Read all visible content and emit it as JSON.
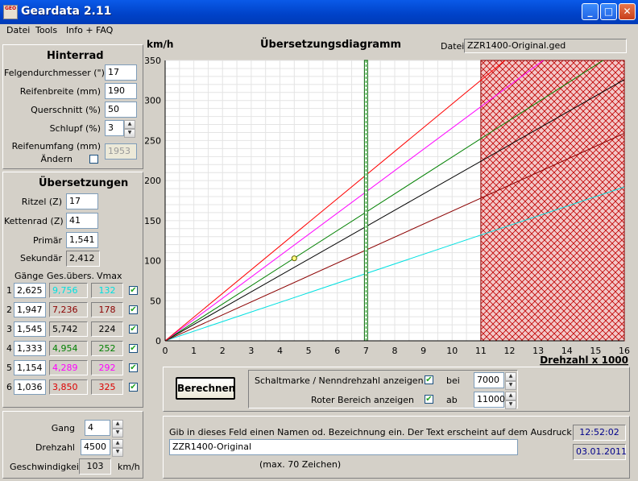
{
  "window": {
    "title": "Geardata 2.11",
    "icon_text": "GEO"
  },
  "menu": [
    "Datei",
    "Tools",
    "Info + FAQ"
  ],
  "hinterrad": {
    "title": "Hinterrad",
    "felge_label": "Felgendurchmesser (\")",
    "felge_value": "17",
    "breite_label": "Reifenbreite (mm)",
    "breite_value": "190",
    "quer_label": "Querschnitt (%)",
    "quer_value": "50",
    "schlupf_label": "Schlupf (%)",
    "schlupf_value": "3",
    "umfang_label": "Reifenumfang (mm)",
    "umfang_value": "1953",
    "aendern_label": "Ändern"
  },
  "uebersetzungen": {
    "title": "Übersetzungen",
    "ritzel_label": "Ritzel (Z)",
    "ritzel_value": "17",
    "kettenrad_label": "Kettenrad (Z)",
    "kettenrad_value": "41",
    "primaer_label": "Primär",
    "primaer_value": "1,541",
    "sekundaer_label": "Sekundär",
    "sekundaer_value": "2,412",
    "col_gaenge": "Gänge",
    "col_ges": "Ges.übers.",
    "col_vmax": "Vmax",
    "gears": [
      {
        "num": "1",
        "ratio": "2,625",
        "ges": "9,756",
        "vmax": "132",
        "color": "#00e0e0"
      },
      {
        "num": "2",
        "ratio": "1,947",
        "ges": "7,236",
        "vmax": "178",
        "color": "#8b0000"
      },
      {
        "num": "3",
        "ratio": "1,545",
        "ges": "5,742",
        "vmax": "224",
        "color": "#000000"
      },
      {
        "num": "4",
        "ratio": "1,333",
        "ges": "4,954",
        "vmax": "252",
        "color": "#008000"
      },
      {
        "num": "5",
        "ratio": "1,154",
        "ges": "4,289",
        "vmax": "292",
        "color": "#ff00ff"
      },
      {
        "num": "6",
        "ratio": "1,036",
        "ges": "3,850",
        "vmax": "325",
        "color": "#dd0000"
      }
    ]
  },
  "status": {
    "gang_label": "Gang",
    "gang_value": "4",
    "drehzahl_label": "Drehzahl",
    "drehzahl_value": "4500",
    "geschw_label": "Geschwindigkeit:",
    "geschw_value": "103",
    "geschw_unit": "km/h"
  },
  "chart_header": {
    "unit": "km/h",
    "title": "Übersetzungsdiagramm",
    "datei_label": "Datei:",
    "datei_value": "ZZR1400-Original.ged"
  },
  "options": {
    "calc_label": "Berechnen",
    "schaltmarke_label": "Schaltmarke / Nenndrehzahl anzeigen",
    "bei_label": "bei",
    "bei_value": "7000",
    "roter_label": "Roter Bereich anzeigen",
    "ab_label": "ab",
    "ab_value": "11000"
  },
  "footer": {
    "hint": "Gib in dieses Feld einen Namen od. Bezeichnung ein. Der Text erscheint auf dem Ausdruck.",
    "name_value": "ZZR1400-Original",
    "max_label": "(max. 70 Zeichen)",
    "time": "12:52:02",
    "date": "03.01.2011"
  },
  "chart_data": {
    "type": "line",
    "xlabel": "Drehzahl x 1000",
    "ylabel": "km/h",
    "xlim": [
      0,
      16
    ],
    "ylim": [
      0,
      350
    ],
    "xticks": [
      "0",
      "1",
      "2",
      "3",
      "4",
      "5",
      "6",
      "7",
      "8",
      "9",
      "10",
      "11",
      "12",
      "13",
      "14",
      "15",
      "16"
    ],
    "yticks": [
      "0",
      "50",
      "100",
      "150",
      "200",
      "250",
      "300",
      "350"
    ],
    "grid": true,
    "series": [
      {
        "gear": "1",
        "x": [
          0,
          16
        ],
        "y": [
          0,
          192
        ],
        "color": "#00e0e0"
      },
      {
        "gear": "2",
        "x": [
          0,
          16
        ],
        "y": [
          0,
          259
        ],
        "color": "#8b0000"
      },
      {
        "gear": "3",
        "x": [
          0,
          16
        ],
        "y": [
          0,
          326
        ],
        "color": "#000000"
      },
      {
        "gear": "4",
        "x": [
          0,
          16
        ],
        "y": [
          0,
          367
        ],
        "color": "#008000"
      },
      {
        "gear": "5",
        "x": [
          0,
          16
        ],
        "y": [
          0,
          425
        ],
        "color": "#ff00ff"
      },
      {
        "gear": "6",
        "x": [
          0,
          16
        ],
        "y": [
          0,
          473
        ],
        "color": "#ff0000"
      }
    ],
    "shift_marker_x": 7,
    "red_zone_start": 11,
    "current_point": {
      "x": 4.5,
      "y": 103
    }
  }
}
